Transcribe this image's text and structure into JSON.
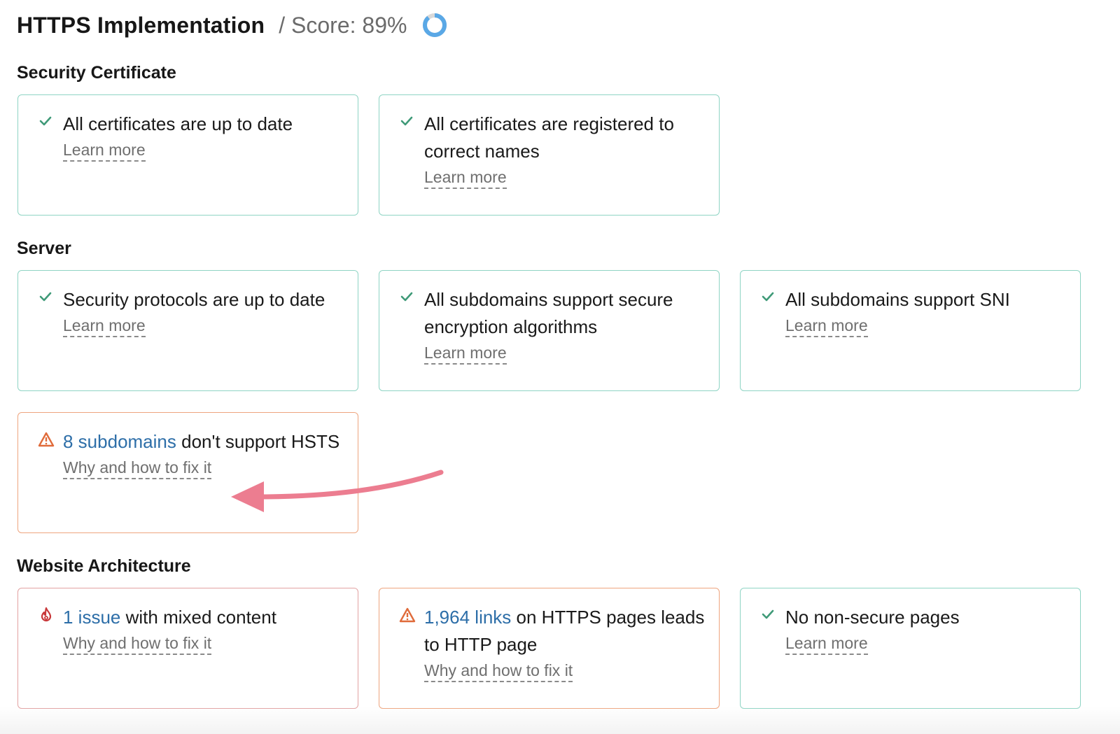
{
  "header": {
    "title": "HTTPS Implementation",
    "score_label": "/ Score: 89%",
    "score_value_percent": 89,
    "score_color": "#5aa8e6"
  },
  "sections": [
    {
      "title": "Security Certificate",
      "cards": [
        {
          "status": "ok",
          "icon": "check-icon",
          "text": "All certificates are up to date",
          "highlight": "",
          "link": "Learn more"
        },
        {
          "status": "ok",
          "icon": "check-icon",
          "text": "All certificates are registered to correct names",
          "highlight": "",
          "link": "Learn more"
        }
      ]
    },
    {
      "title": "Server",
      "cards": [
        {
          "status": "ok",
          "icon": "check-icon",
          "text": "Security protocols are up to date",
          "highlight": "",
          "link": "Learn more"
        },
        {
          "status": "ok",
          "icon": "check-icon",
          "text": "All subdomains support secure encryption algorithms",
          "highlight": "",
          "link": "Learn more"
        },
        {
          "status": "ok",
          "icon": "check-icon",
          "text": "All subdomains support SNI",
          "highlight": "",
          "link": "Learn more"
        },
        {
          "status": "warning",
          "icon": "warning-icon",
          "highlight": "8 subdomains",
          "text": " don't support HSTS",
          "link": "Why and how to fix it"
        }
      ]
    },
    {
      "title": "Website Architecture",
      "cards": [
        {
          "status": "error",
          "icon": "fire-icon",
          "highlight": "1 issue",
          "text": " with mixed content",
          "link": "Why and how to fix it"
        },
        {
          "status": "warning",
          "icon": "warning-icon",
          "highlight": "1,964 links",
          "text": " on HTTPS pages leads to HTTP page",
          "link": "Why and how to fix it"
        },
        {
          "status": "ok",
          "icon": "check-icon",
          "text": "No non-secure pages",
          "highlight": "",
          "link": "Learn more"
        }
      ]
    }
  ],
  "colors": {
    "ok": "#3f9a78",
    "warning": "#e06b3a",
    "error": "#c8383a",
    "link_highlight": "#2d6ea8",
    "annotation_arrow": "#ec7d90"
  }
}
